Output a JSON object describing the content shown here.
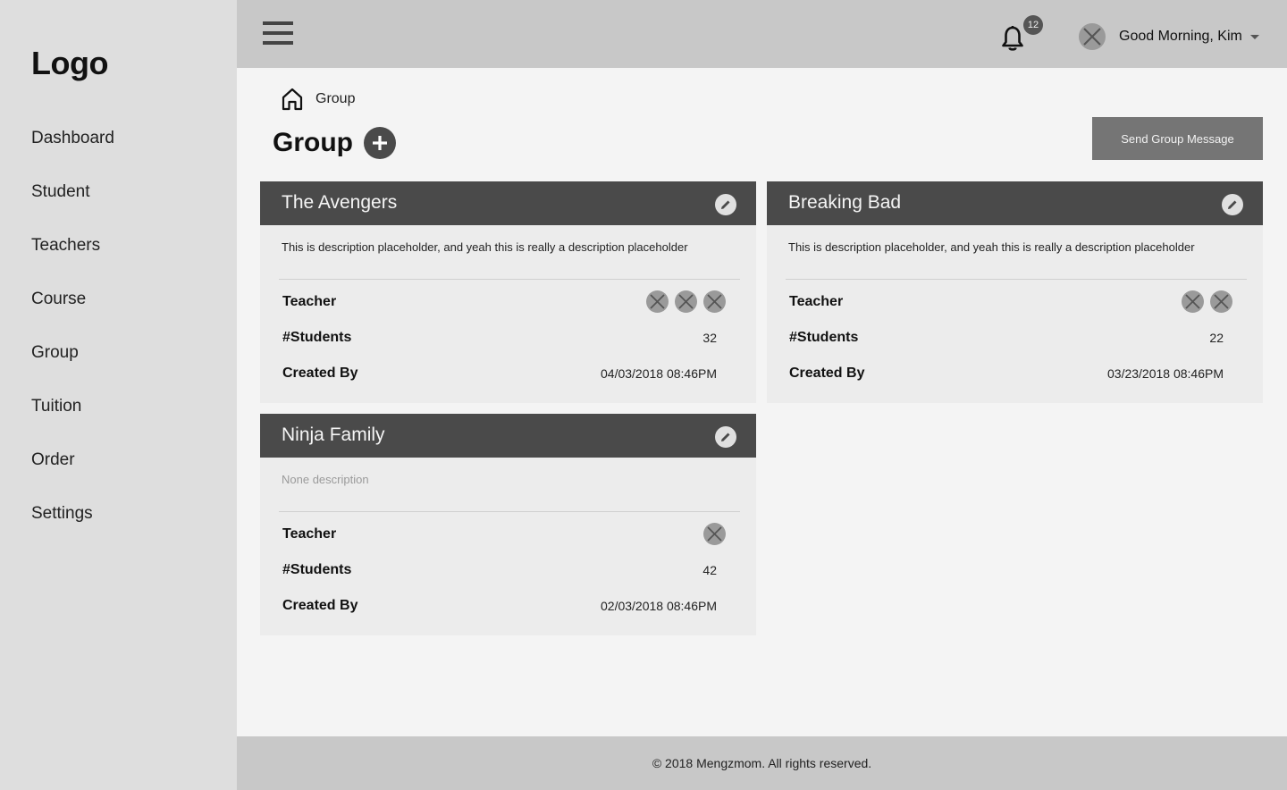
{
  "sidebar": {
    "logo": "Logo",
    "items": [
      {
        "label": "Dashboard"
      },
      {
        "label": "Student"
      },
      {
        "label": "Teachers"
      },
      {
        "label": "Course"
      },
      {
        "label": "Group"
      },
      {
        "label": "Tuition"
      },
      {
        "label": "Order"
      },
      {
        "label": "Settings"
      }
    ]
  },
  "header": {
    "menu_icon": "hamburger-icon",
    "notification_count": "12",
    "greeting": "Good Morning, Kim"
  },
  "breadcrumb": {
    "home_icon": "home-icon",
    "current": "Group"
  },
  "page": {
    "title": "Group",
    "add_icon": "plus-icon",
    "send_button": "Send Group Message"
  },
  "groups": [
    {
      "name": "The Avengers",
      "description": "This is description placeholder, and yeah this is really a description placeholder",
      "teacher_label": "Teacher",
      "teacher_count": 3,
      "students_label": "#Students",
      "students": "32",
      "created_label": "Created By",
      "created": "04/03/2018  08:46PM"
    },
    {
      "name": "Breaking Bad",
      "description": "This is description placeholder, and yeah this is really a description placeholder",
      "teacher_label": "Teacher",
      "teacher_count": 2,
      "students_label": "#Students",
      "students": "22",
      "created_label": "Created By",
      "created": "03/23/2018  08:46PM"
    },
    {
      "name": "Ninja Family",
      "description": "None description",
      "teacher_label": "Teacher",
      "teacher_count": 1,
      "students_label": "#Students",
      "students": "42",
      "created_label": "Created By",
      "created": "02/03/2018  08:46PM"
    }
  ],
  "footer": {
    "text": "© 2018 Mengzmom. All rights reserved."
  },
  "colors": {
    "sidebar_bg": "#dedede",
    "topbar_bg": "#c8c8c8",
    "card_header": "#4a4a4a",
    "card_body": "#ececec",
    "button": "#757575"
  }
}
